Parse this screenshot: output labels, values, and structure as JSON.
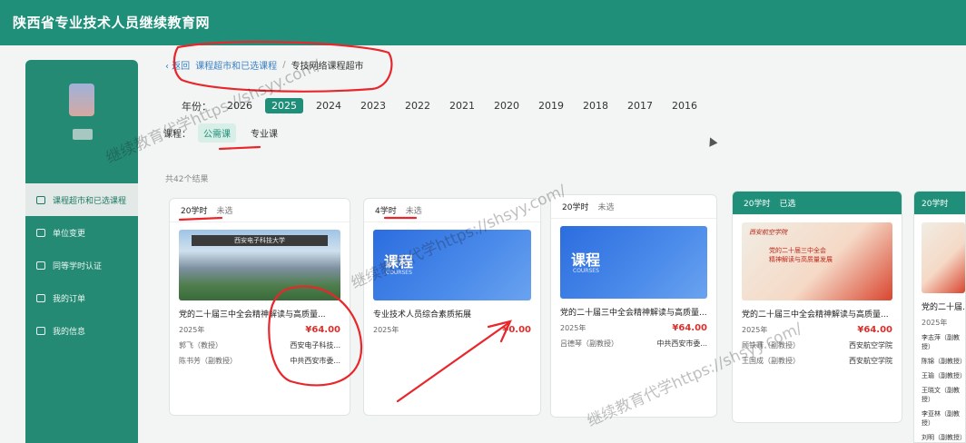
{
  "site": {
    "title": "陕西省专业技术人员继续教育网"
  },
  "breadcrumb": {
    "back": "‹ 返回",
    "parent": "课程超市和已选课程",
    "sep": "/",
    "current": "专技网络课程超市"
  },
  "filters": {
    "year_label": "年份：",
    "years": [
      "2026",
      "2025",
      "2024",
      "2023",
      "2022",
      "2021",
      "2020",
      "2019",
      "2018",
      "2017",
      "2016"
    ],
    "type_label": "课程：",
    "types": [
      "公需课",
      "专业课"
    ]
  },
  "results": {
    "count_text": "共42个结果"
  },
  "sidebar": {
    "items": [
      {
        "label": "课程超市和已选课程"
      },
      {
        "label": "单位变更"
      },
      {
        "label": "同等学时认证"
      },
      {
        "label": "我的订单"
      },
      {
        "label": "我的信息"
      }
    ]
  },
  "cards": [
    {
      "hours": "20学时",
      "status": "未选",
      "thumb_text": "西安电子科技大学",
      "title": "党的二十届三中全会精神解读与高质量...",
      "year": "2025年",
      "price": "¥64.00",
      "t1": "郭飞（教授）",
      "i1": "西安电子科技...",
      "t2": "陈书芳（副教授）",
      "i2": "中共西安市委..."
    },
    {
      "hours": "4学时",
      "status": "未选",
      "thumb_text": "课程",
      "thumb_sub": "COURSES",
      "title": "专业技术人员综合素质拓展",
      "year": "2025年",
      "price": "¥0.00"
    },
    {
      "hours": "20学时",
      "status": "未选",
      "thumb_text": "课程",
      "thumb_sub": "COURSES",
      "title": "党的二十届三中全会精神解读与高质量...",
      "year": "2025年",
      "price": "¥64.00",
      "t1": "吕德琴（副教授）",
      "i1": "中共西安市委..."
    },
    {
      "hours": "20学时",
      "status": "已选",
      "thumb_logo": "西安航空学院",
      "thumb_text": "党的二十届三中全会\n精神解读与高质量发展",
      "title": "党的二十届三中全会精神解读与高质量...",
      "year": "2025年",
      "price": "¥64.00",
      "t1": "顾铁骞（副教授）",
      "i1": "西安航空学院",
      "t2": "王国成（副教授）",
      "i2": "西安航空学院"
    },
    {
      "hours": "20学时",
      "status": "",
      "title": "党的二十届...",
      "year": "2025年",
      "t1": "李志萍（副教授）",
      "t2": "陈锦（副教授）",
      "t3": "王瑜（副教授）",
      "t4": "王晓文（副教授）",
      "t5": "李亚林（副教授）",
      "t6": "刘明（副教授）"
    }
  ],
  "watermark": {
    "text": "继续教育代学https://shsyy.com/"
  },
  "colors": {
    "brand": "#1f8f79",
    "price": "#d9302c",
    "annotation": "#e8262b"
  }
}
